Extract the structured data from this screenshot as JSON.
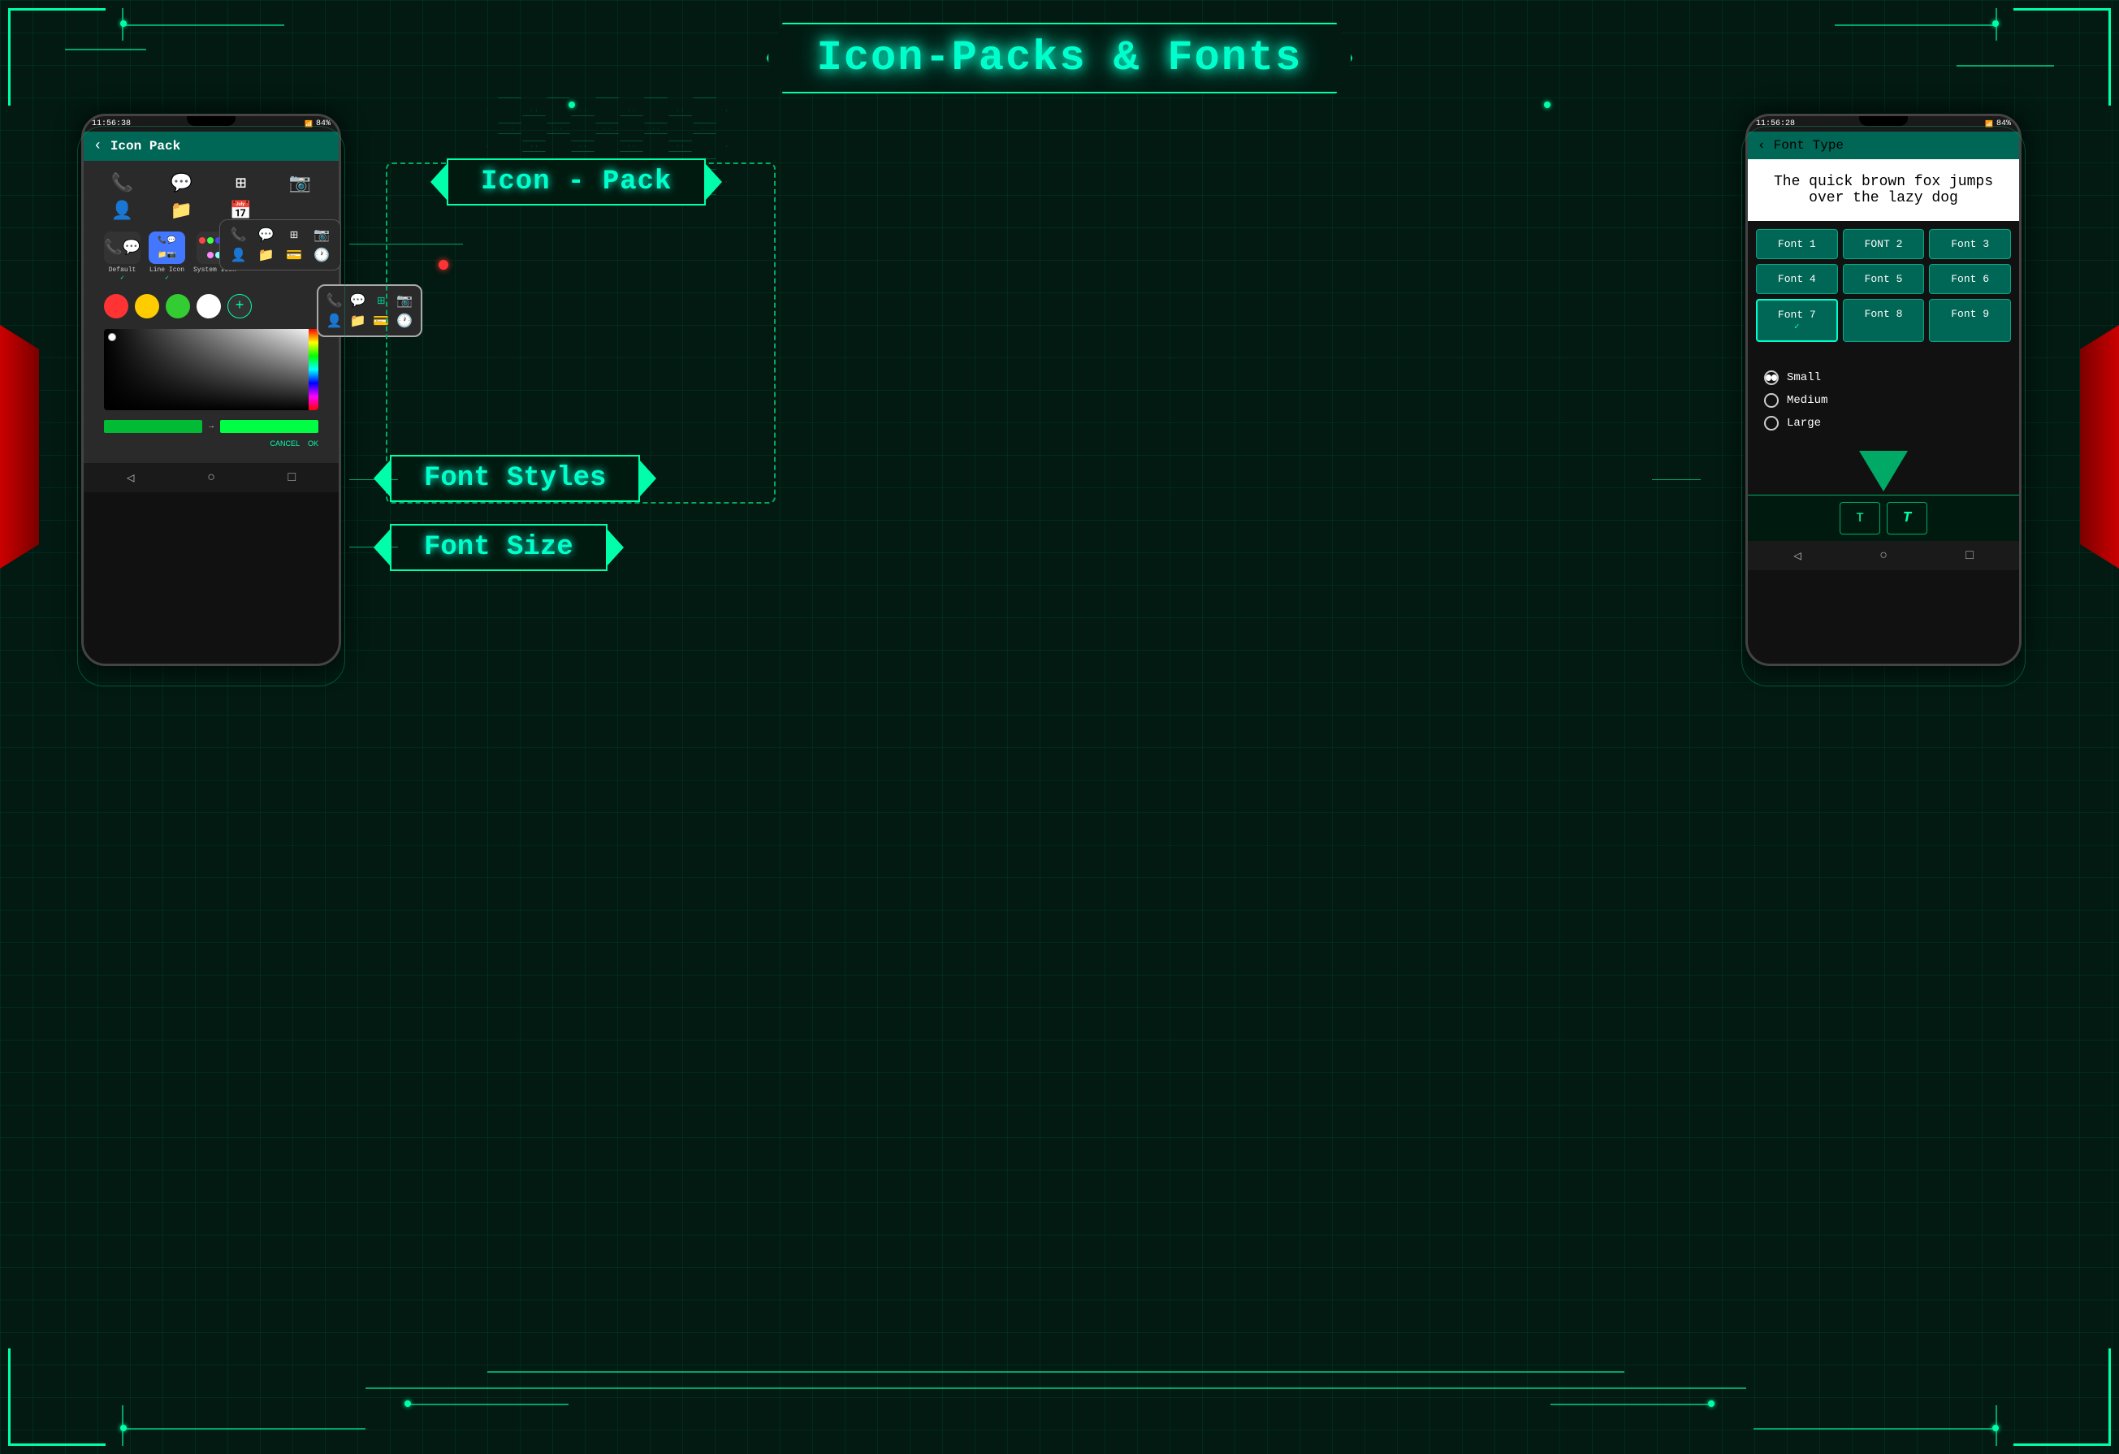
{
  "app": {
    "title": "Icon-Packs & Fonts"
  },
  "banner_icon_pack": {
    "label": "Icon - Pack"
  },
  "banner_font_styles": {
    "label": "Font Styles"
  },
  "banner_font_size": {
    "label": "Font Size"
  },
  "phone_left": {
    "status_time": "11:56:38",
    "status_battery": "84%",
    "top_bar_title": "Icon Pack",
    "back_label": "‹",
    "icon_types": [
      {
        "label": "Default",
        "check": "✓",
        "type": "default"
      },
      {
        "label": "Line Icon",
        "check": "✓",
        "type": "line"
      },
      {
        "label": "System Icon",
        "check": "",
        "type": "system"
      }
    ],
    "color_circles": [
      "red",
      "yellow",
      "green",
      "white"
    ],
    "add_btn_label": "+",
    "cancel_btn": "CANCEL",
    "ok_btn": "OK"
  },
  "phone_right": {
    "status_time": "11:56:28",
    "status_battery": "84%",
    "top_bar_title": "Font Type",
    "back_label": "‹",
    "preview_text": "The quick brown fox jumps over the lazy dog",
    "fonts": [
      {
        "label": "Font 1",
        "selected": false
      },
      {
        "label": "FONT 2",
        "selected": false
      },
      {
        "label": "Font 3",
        "selected": false
      },
      {
        "label": "Font 4",
        "selected": false
      },
      {
        "label": "Font 5",
        "selected": false
      },
      {
        "label": "Font 6",
        "selected": false
      },
      {
        "label": "Font 7",
        "selected": true,
        "check": "✓"
      },
      {
        "label": "Font 8",
        "selected": false
      },
      {
        "label": "Font 9",
        "selected": false
      }
    ],
    "size_options": [
      {
        "label": "Small",
        "selected": true
      },
      {
        "label": "Medium",
        "selected": false
      },
      {
        "label": "Large",
        "selected": false
      }
    ]
  },
  "nav": {
    "back": "◁",
    "home": "○",
    "recent": "□"
  }
}
